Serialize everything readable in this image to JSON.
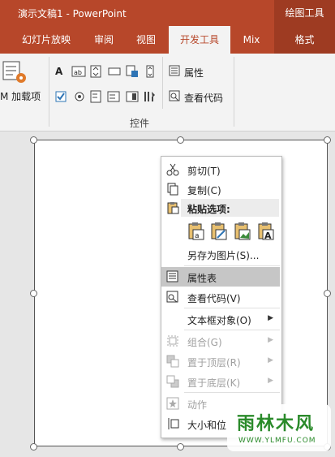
{
  "window": {
    "title": "演示文稿1  -  PowerPoint",
    "tool_title": "绘图工具"
  },
  "tabs": [
    {
      "label": "幻灯片放映"
    },
    {
      "label": "审阅"
    },
    {
      "label": "视图"
    },
    {
      "label": "开发工具",
      "active": true
    },
    {
      "label": "Mix"
    },
    {
      "label": "格式"
    }
  ],
  "ribbon": {
    "addins_label": "M 加载项",
    "properties_label": "属性",
    "view_code_label": "查看代码",
    "controls_group_label": "控件"
  },
  "context_menu": {
    "cut": "剪切(T)",
    "copy": "复制(C)",
    "paste_options": "粘贴选项:",
    "save_as_picture": "另存为图片(S)...",
    "properties_sheet": "属性表",
    "view_code": "查看代码(V)",
    "textbox_object": "文本框对象(O)",
    "group": "组合(G)",
    "bring_to_front": "置于顶层(R)",
    "send_to_back": "置于底层(K)",
    "action": "动作",
    "size_position": "大小和位"
  },
  "watermark": {
    "text": "雨林木风",
    "url": "WWW.YLMFU.COM"
  },
  "colors": {
    "accent": "#b7472a",
    "highlight": "#c6c6c6"
  }
}
